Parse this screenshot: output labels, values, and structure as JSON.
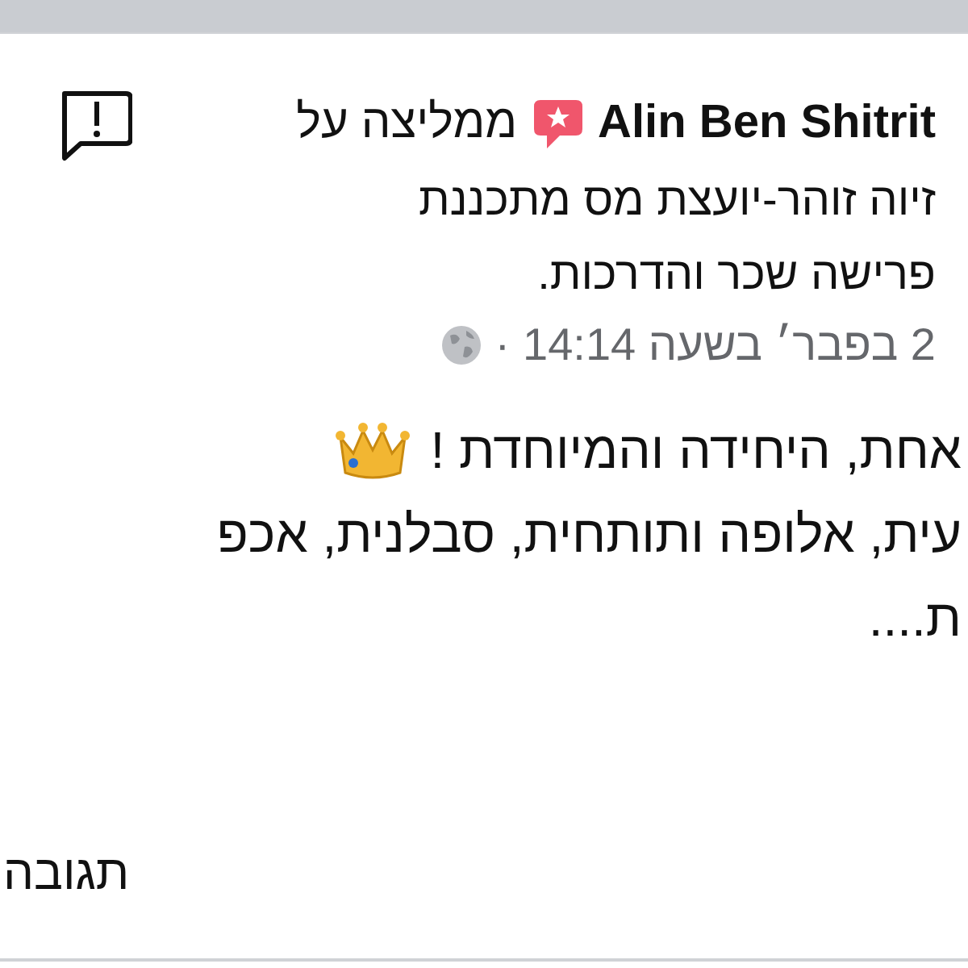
{
  "post": {
    "author": "Alin Ben Shitrit",
    "action": "ממליצה על",
    "page": "זיוה זוהר-יועצת מס מתכננת פרישה שכר והדרכות.",
    "timestamp": "2 בפבר׳ בשעה 14:14",
    "separator": "·",
    "body_lines": [
      "אחת, היחידה והמיוחדת !",
      "עית, אלופה ותותחית, סבלנית, אכפ",
      "ת...."
    ]
  },
  "actions": [
    {
      "label": "תגובה"
    }
  ]
}
